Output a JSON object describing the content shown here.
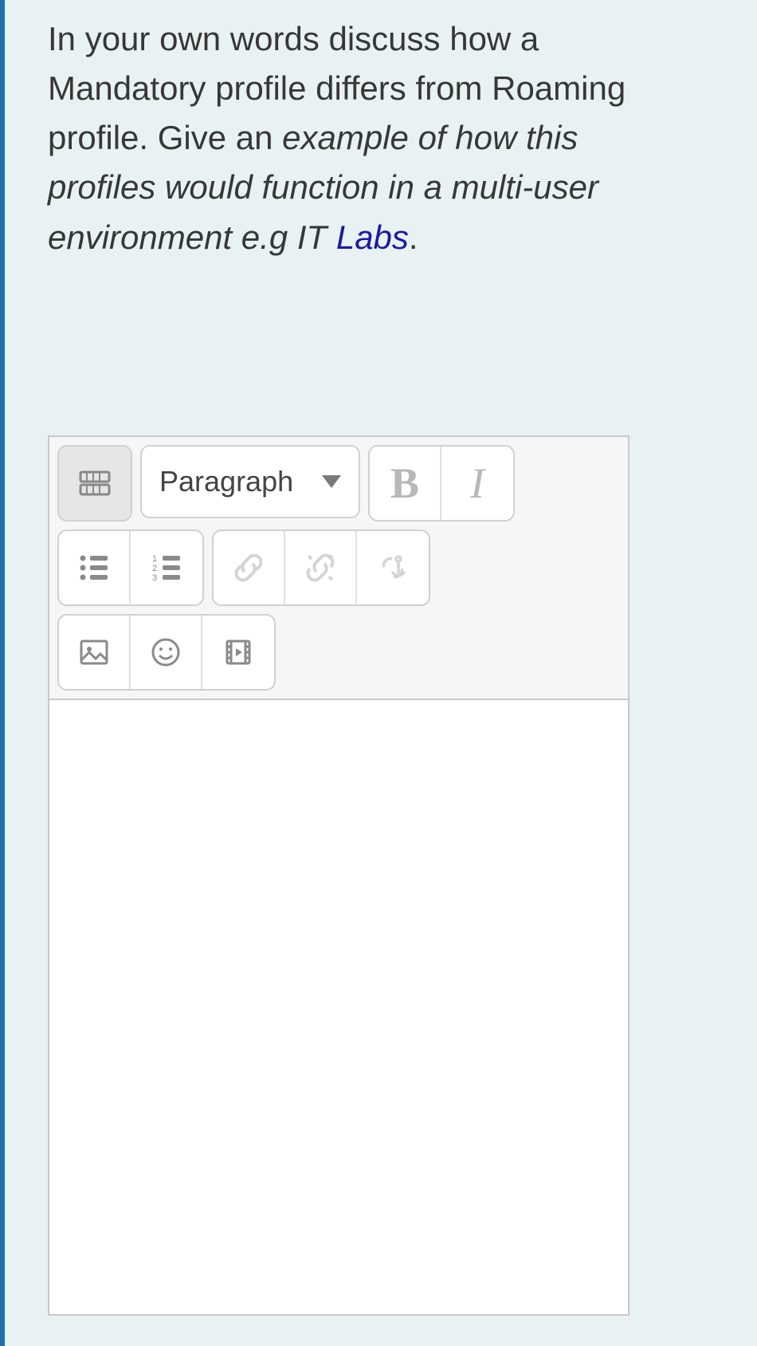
{
  "question": {
    "line1": "In your own words discuss  how a Mandatory profile differs from Roaming profile. Give an ",
    "italic": "example of how this profiles would function in a multi-user environment e.g IT ",
    "link": "Labs",
    "period": "."
  },
  "toolbar": {
    "format_sel": "Paragraph",
    "bold": "B",
    "italic": "I"
  },
  "icons": {
    "toggle": "toggle-toolbar-icon",
    "bullet": "bullet-list-icon",
    "numbered": "numbered-list-icon",
    "link": "link-icon",
    "unlink": "unlink-icon",
    "anchor": "anchor-icon",
    "image": "image-icon",
    "emoji": "emoji-icon",
    "media": "media-icon"
  }
}
